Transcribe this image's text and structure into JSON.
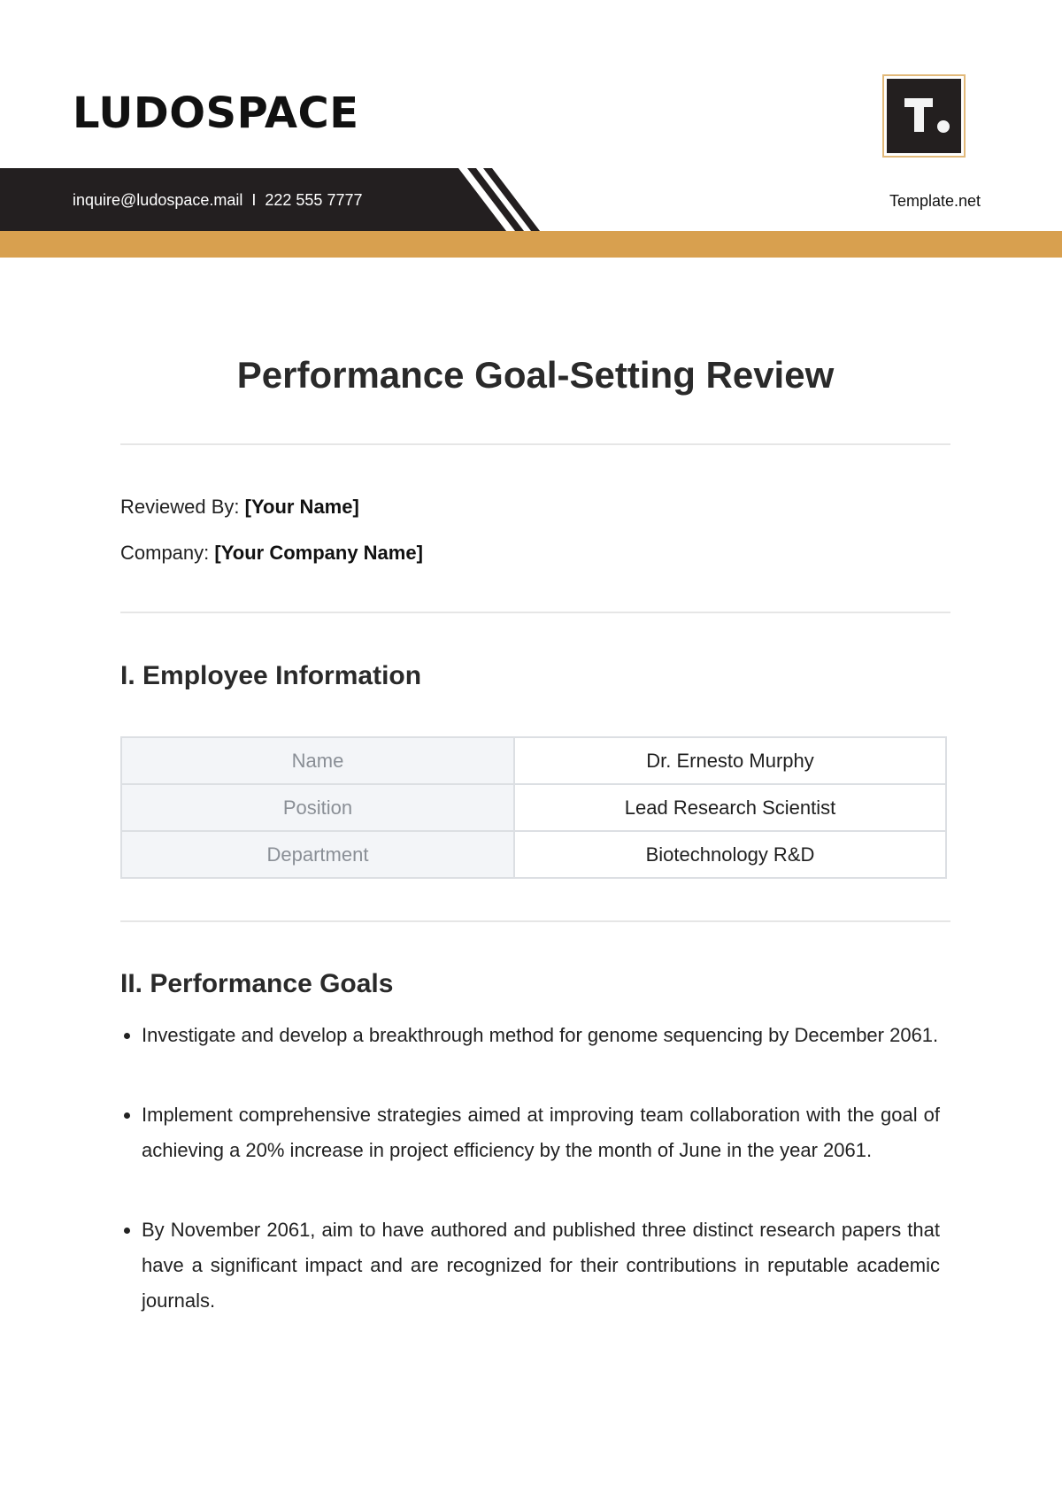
{
  "header": {
    "brand": "LUDOSPACE",
    "contact": "inquire@ludospace.mail  I  222 555 7777",
    "logo_icon": "template-net-logo-icon",
    "logo_label": "Template.net",
    "colors": {
      "dark_band": "#231f20",
      "gold_band": "#d8a04f"
    }
  },
  "document": {
    "title": "Performance Goal-Setting Review",
    "reviewed_by_label": "Reviewed By:",
    "reviewed_by_value": "[Your Name]",
    "company_label": "Company:",
    "company_value": "[Your Company Name]"
  },
  "employee_section": {
    "heading": "I. Employee Information",
    "rows": [
      {
        "label": "Name",
        "value": "Dr. Ernesto Murphy"
      },
      {
        "label": "Position",
        "value": "Lead Research Scientist"
      },
      {
        "label": "Department",
        "value": "Biotechnology R&D"
      }
    ]
  },
  "goals_section": {
    "heading": "II. Performance Goals",
    "items": [
      "Investigate and develop a breakthrough method for genome sequencing by December 2061.",
      "Implement comprehensive strategies aimed at improving team collaboration with the goal of achieving a 20% increase in project efficiency by the month of June in the year 2061.",
      "By November 2061, aim to have authored and published three distinct research papers that have a significant impact and are recognized for their contributions in reputable academic journals."
    ]
  }
}
